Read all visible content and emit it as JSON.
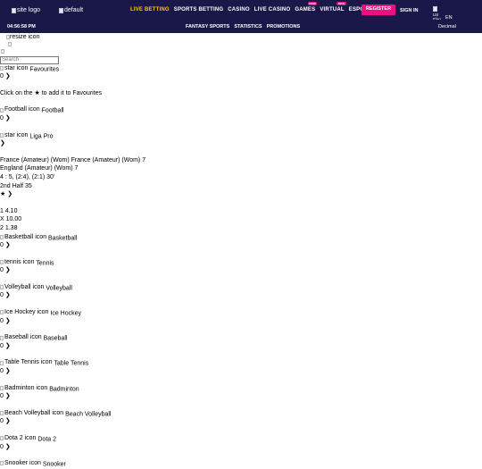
{
  "header": {
    "logo_alt": "site logo",
    "flag_alt": "default",
    "nav": [
      {
        "label": "LIVE BETTING",
        "active": true,
        "badge": ""
      },
      {
        "label": "SPORTS BETTING",
        "active": false,
        "badge": ""
      },
      {
        "label": "CASINO",
        "active": false,
        "badge": ""
      },
      {
        "label": "LIVE CASINO",
        "active": false,
        "badge": ""
      },
      {
        "label": "GAMES",
        "active": false,
        "badge": "new"
      },
      {
        "label": "VIRTUAL",
        "active": false,
        "badge": "new"
      },
      {
        "label": "ESPORTS",
        "active": false,
        "badge": ""
      }
    ],
    "register_label": "REGISTER",
    "signin_label": "SIGN IN",
    "lang_flag_alt": "US Flag icon",
    "lang_code": "EN",
    "odds_format": "Decimal"
  },
  "subheader": {
    "time": "04:56:58 PM",
    "links": [
      "FANTASY SPORTS",
      "STATISTICS",
      "PROMOTIONS"
    ]
  },
  "sidebar": {
    "resize_alt": "resize icon",
    "search_placeholder": "Search",
    "favourites": {
      "icon_alt": "star icon",
      "label": "Favourites",
      "count": "0 ❯",
      "hint": "Click on the ★ to add it to Favourites"
    },
    "football": {
      "icon_alt": "Football icon",
      "label": "Football",
      "count": "0 ❯"
    },
    "liga_pro": {
      "icon_alt": "star icon",
      "label": "Liga Pro",
      "arrow": "❯"
    },
    "match": {
      "home_line": "France (Amateur) (Wom) France (Amateur) (Wom) 7",
      "away_line": "England (Amateur) (Wom) 7",
      "score_line": "4 : 5, (2:4), (2:1) 30'",
      "period_line": "2nd Half 35",
      "star_line": "★ ❯",
      "odds": [
        "1 4.10",
        "X 10.00",
        "2 1.38"
      ]
    },
    "sports": [
      {
        "icon_alt": "Basketball icon",
        "label": "Basketball",
        "count": "0 ❯"
      },
      {
        "icon_alt": "tennis icon",
        "label": "Tennis",
        "count": "0 ❯"
      },
      {
        "icon_alt": "Volleyball icon",
        "label": "Volleyball",
        "count": "0 ❯"
      },
      {
        "icon_alt": "Ice Hockey icon",
        "label": "Ice Hockey",
        "count": "0 ❯"
      },
      {
        "icon_alt": "Baseball icon",
        "label": "Baseball",
        "count": "0 ❯"
      },
      {
        "icon_alt": "Table Tennis icon",
        "label": "Table Tennis",
        "count": "0 ❯"
      },
      {
        "icon_alt": "Badminton icon",
        "label": "Badminton",
        "count": "0 ❯"
      },
      {
        "icon_alt": "Beach Volleyball icon",
        "label": "Beach Volleyball",
        "count": "0 ❯"
      },
      {
        "icon_alt": "Dota 2 icon",
        "label": "Dota 2",
        "count": "0 ❯"
      },
      {
        "icon_alt": "Snooker icon",
        "label": "Snooker",
        "count": ""
      }
    ]
  }
}
